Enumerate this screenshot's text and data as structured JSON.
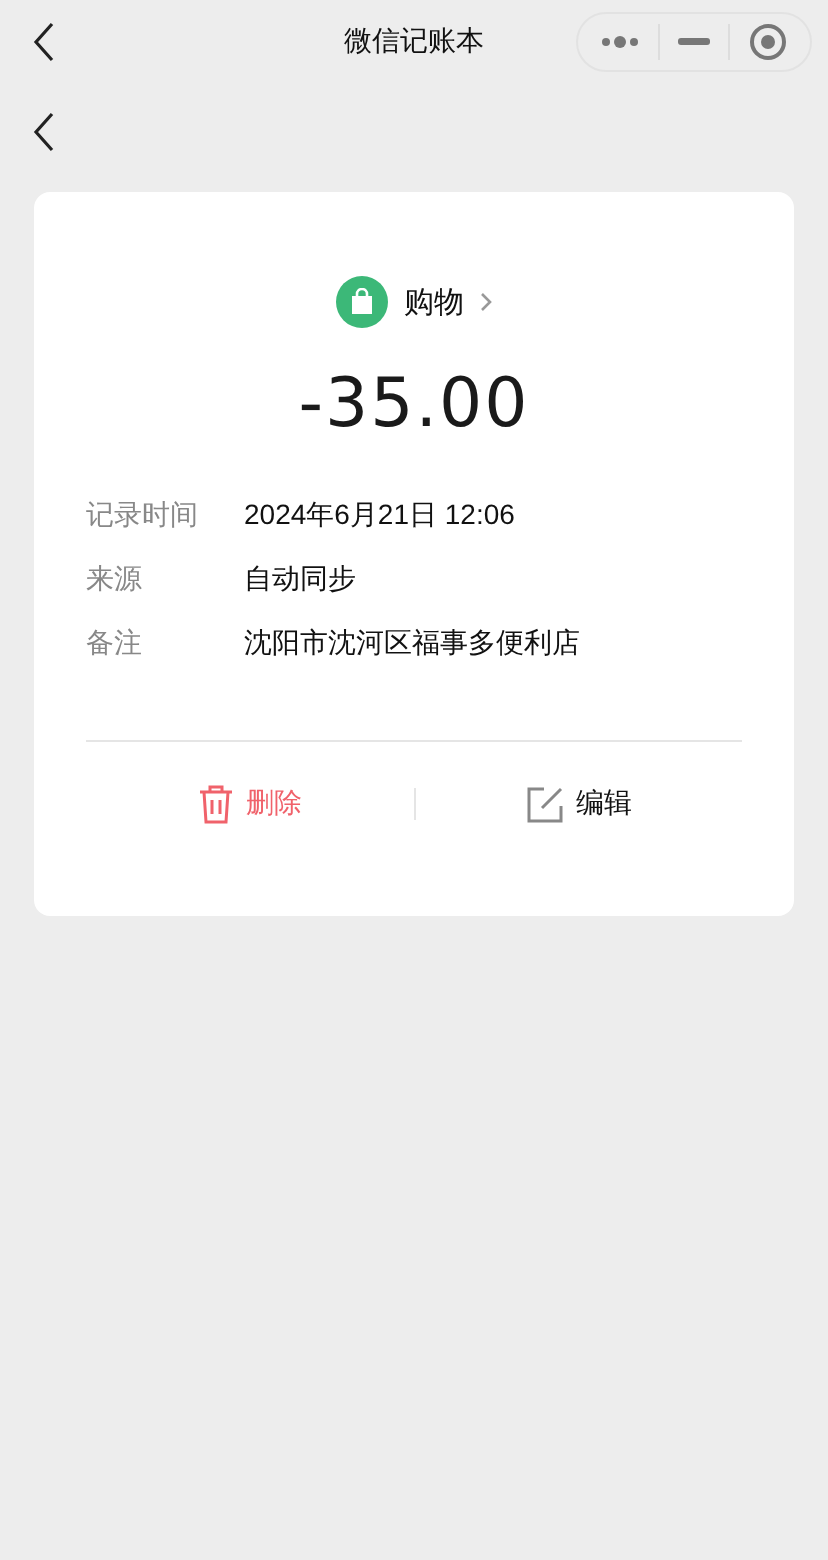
{
  "nav_bar": {
    "title": "微信记账本"
  },
  "category": {
    "label": "购物",
    "color": "#3cb878"
  },
  "amount": "-35.00",
  "details": [
    {
      "label": "记录时间",
      "value": "2024年6月21日 12:06"
    },
    {
      "label": "来源",
      "value": "自动同步"
    },
    {
      "label": "备注",
      "value": "沈阳市沈河区福事多便利店"
    }
  ],
  "actions": [
    {
      "kind": "delete",
      "label": "删除"
    },
    {
      "kind": "edit",
      "label": "编辑"
    }
  ]
}
